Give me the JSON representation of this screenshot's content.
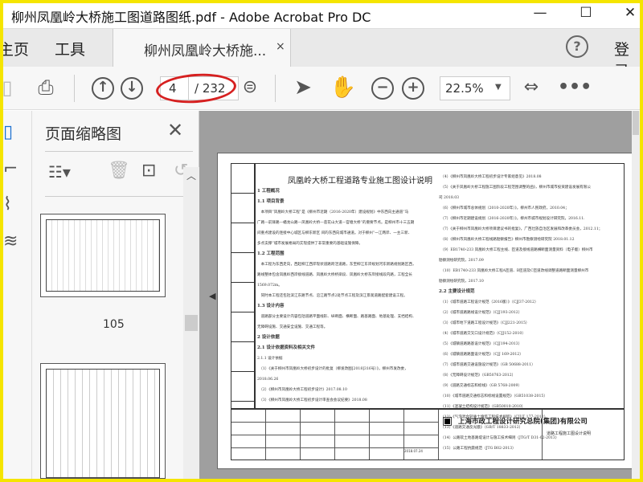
{
  "window": {
    "title": "柳州凤凰岭大桥施工图道路图纸.pdf - Adobe Acrobat Pro DC",
    "minimize": "—",
    "maximize": "☐",
    "close": "✕"
  },
  "tabs": {
    "home": "主页",
    "tools": "工具",
    "doc_tab": "柳州凤凰岭大桥施...",
    "doc_tab_close": "×",
    "help": "?",
    "login": "登录"
  },
  "toolbar": {
    "current_page": "4",
    "total_pages": "/ 232",
    "zoom": "22.5%",
    "highlight_color": "#d62020",
    "hand_color": "#1a6fd0"
  },
  "sidebar": {
    "title": "页面缩略图",
    "thumbnails": [
      {
        "label": "105"
      },
      {
        "label": ""
      }
    ]
  },
  "document": {
    "title": "凤凰岭大桥工程道路专业施工图设计说明",
    "left_column": [
      {
        "t": "1 工程概况",
        "h": true
      },
      {
        "t": "1.1 项目背景",
        "h": true
      },
      {
        "t": "　本项目“凤凰岭大桥工程”是《柳州市近期（2016-2020年）建设规划》中东西向主通道“马"
      },
      {
        "t": "广路—前锋路—蟠龙山路—凤凰岭大桥—莲花山大道—官塘大桥”的重要节点。是柳州市十三五期"
      },
      {
        "t": "间重点建设的连接中心城区与柳东新区 间的东西向城市通道。对于柳州“一江两岸、一主三新、"
      },
      {
        "t": "多点支撑”城市发展格局的实现提供了非常重要的基础设施保障。"
      },
      {
        "t": "1.2 工程范围",
        "h": true
      },
      {
        "t": "　本工程为东西走向，西起柳江西岸现状道路跨活道路，东至柳江东岸规划河东新路规划路区西，"
      },
      {
        "t": "路线整体包含凤凰岭西岸接线道路、凤凰岭大桥桥梁段、凤凰岭大桥东岸接线段内路，工程全长"
      },
      {
        "t": "1569.072m。"
      },
      {
        "t": "　同时本工程还包括滨江东路节点、沿江路节点2处节点工程及滨江景观道路配套建设工程。"
      },
      {
        "t": "1.3 设计内容",
        "h": true
      },
      {
        "t": "　道路部分主要设计内容包括道路平面线形、纵断面、横断面、路基路面、地基处理、支挡结构、"
      },
      {
        "t": "无障碍设施、交通安全设施、交通工程等。"
      },
      {
        "t": "2 设计依据",
        "h": true
      },
      {
        "t": "2.1 设计依据资料及相关文件",
        "h": true
      },
      {
        "t": "2.1.1 设计依据"
      },
      {
        "t": "　（1）《关于柳州市凤凰岭大桥初步设计的批复（柳发改图[2018]316号）》，柳州市发改委，"
      },
      {
        "t": "2018.06.26"
      },
      {
        "t": "　（2）《柳州市凤凰岭大桥工程初步设计》2017.08.10"
      },
      {
        "t": "　（3）《柳州市凤凰岭大桥工程初步设计审查会会议纪要》2018.08"
      }
    ],
    "right_column": [
      {
        "t": "　（4）《柳州市凤凰岭大桥工程初步设计专家组意见》2018.08"
      },
      {
        "t": "　（5）《关于凤凰岭大桥工程施工图阶段工程范围调整的函》，柳州市城市投资建设发展有限公"
      },
      {
        "t": "司 2018.03"
      },
      {
        "t": "　（6）《柳州市城市总体规划（2010-2020年）》，柳州市人民政府，2010.04；"
      },
      {
        "t": "　（7）《柳州市近期建设规划（2016-2020年）》，柳州市城市规划设计研究院，2016.11."
      },
      {
        "t": "　（7）《关于柳州市凤凰岭大桥项目建议书的批复》，广西壮族自治区发展和改革委员会，2012.11；"
      },
      {
        "t": "　（8）《柳州市凤凰岭大桥工程线路勘察报告》柳州市勘察测绘研究院 2018.01.12"
      },
      {
        "t": "　（9）EB1740-233 凤凰岭大桥工程主线、匝道及接线道路横断面测量资料（电子版）柳州市"
      },
      {
        "t": "勘察测绘研究院，2017.09"
      },
      {
        "t": "　（10）EB1740-233 凤凰岭大桥工程A匝道、B匝道及C匝道改线调整道路断面测量柳州市"
      },
      {
        "t": "勘察测绘研究院，2017.10"
      },
      {
        "t": "2.2 主要设计规范",
        "h": true
      },
      {
        "t": "　（1）《城市道路工程设计规范（2016版）》（CJJ37-2012）"
      },
      {
        "t": "　（2）《城市道路路线设计规范》（CJJ193-2012）"
      },
      {
        "t": "　（3）《城市地下道路工程设计规范》（CJJ221-2015）"
      },
      {
        "t": "　（4）《城市道路交叉口设计规范》（CJJ152-2010）"
      },
      {
        "t": "　（5）《城镇道路路基设计规范》（CJJ194-2013）"
      },
      {
        "t": "　（6）《城镇道路路面设计规范》（CJJ 169-2012）"
      },
      {
        "t": "　（7）《城市道路交通设施设计规范》（GB 50688-2011）"
      },
      {
        "t": "　（8）《无障碍设计规范》（GB50763-2012）"
      },
      {
        "t": "　（9）《道路交通标志和标线》（GB 5768-2009）"
      },
      {
        "t": "　（10）《城市道路交通标志和标线设置规范》（GB51038-2015）"
      },
      {
        "t": "　（11）《混凝土结构设计规范》（GB50010-2010）"
      },
      {
        "t": "　（12）《气泡混合轻质土填筑工程技术规程》（CJJ/T 177-2012）"
      },
      {
        "t": "　（13）《道路交通反光膜》（GB/T 18833-2012）"
      },
      {
        "t": "　（14）公路软土地基路堤设计与施工技术细则（JTG/T D31-02-2013）"
      },
      {
        "t": "　（15）公路工程抗震规范（JTG B02-2013）"
      }
    ],
    "title_block": {
      "company": "上海市政工程设计研究总院(集团)有限公司",
      "date": "2018.07.24",
      "drawing_name": "道路工程施工图设计说明"
    }
  }
}
